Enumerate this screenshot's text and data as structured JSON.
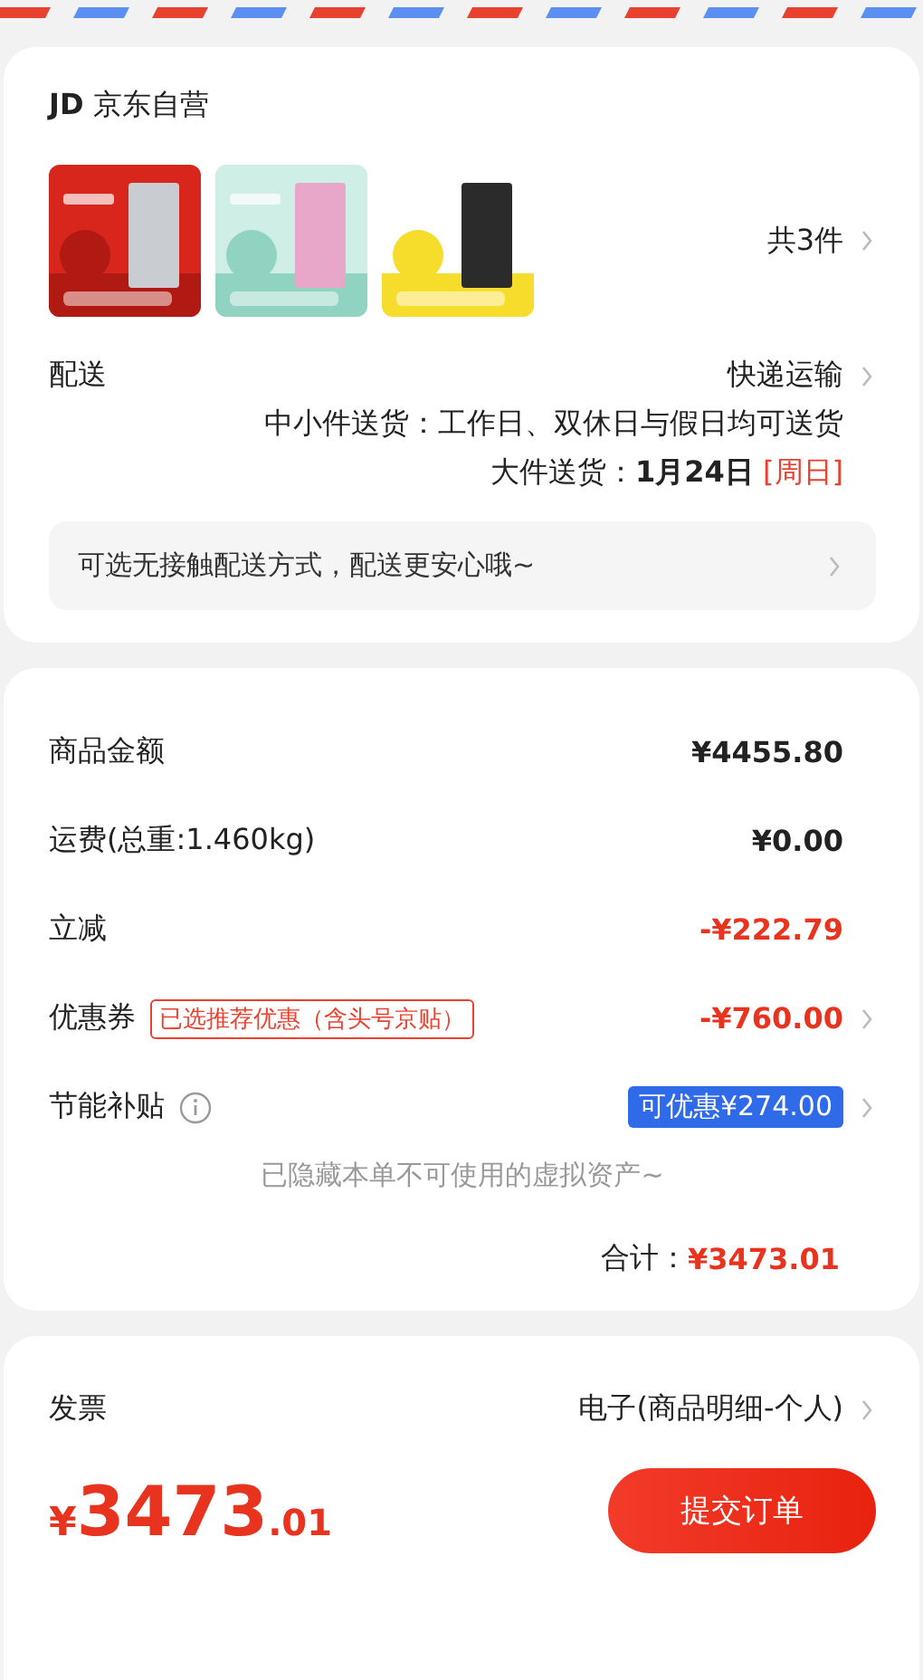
{
  "shop": {
    "logo": "JD",
    "name": "京东自营"
  },
  "products": {
    "count": "共3件"
  },
  "delivery": {
    "label": "配送",
    "method": "快递运输",
    "small_items": "中小件送货：工作日、双休日与假日均可送货",
    "large_label": "大件送货：",
    "large_date": "1月24日",
    "large_weekday": "[周日]"
  },
  "contactless": {
    "text": "可选无接触配送方式，配送更安心哦~"
  },
  "amounts": [
    {
      "kind": "plain",
      "label": "商品金额",
      "value": "¥4455.80",
      "chevron": false
    },
    {
      "kind": "plain",
      "label": "运费(总重:1.460kg)",
      "value": "¥0.00",
      "chevron": false
    },
    {
      "kind": "discount",
      "label": "立减",
      "value": "-¥222.79",
      "chevron": false
    },
    {
      "kind": "coupon",
      "label": "优惠券",
      "tag": "已选推荐优惠（含头号京贴）",
      "value": "-¥760.00",
      "chevron": true
    },
    {
      "kind": "subsidy",
      "label": "节能补贴",
      "value": "可优惠¥274.00",
      "chevron": true
    }
  ],
  "hidden_note": "已隐藏本单不可使用的虚拟资产~",
  "total": {
    "label": "合计：",
    "value": "¥3473.01"
  },
  "invoice": {
    "label": "发票",
    "value": "电子(商品明细-个人)"
  },
  "footer": {
    "symbol": "¥",
    "integer": "3473",
    "decimal": ".01",
    "submit": "提交订单"
  }
}
